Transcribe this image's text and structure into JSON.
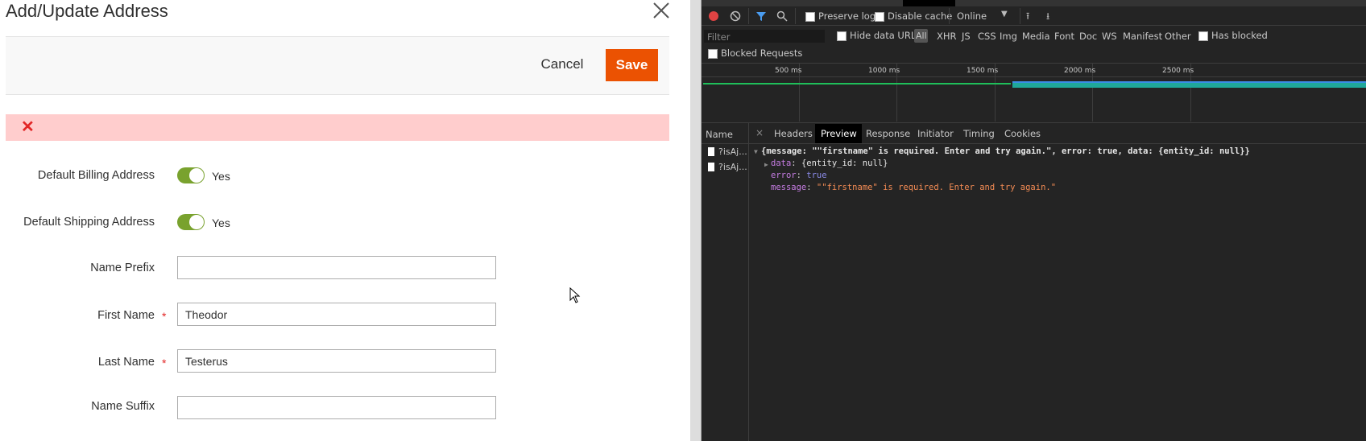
{
  "modal": {
    "title": "Add/Update Address",
    "cancel_label": "Cancel",
    "save_label": "Save",
    "fields": {
      "default_billing": {
        "label": "Default Billing Address",
        "value": "Yes"
      },
      "default_shipping": {
        "label": "Default Shipping Address",
        "value": "Yes"
      },
      "name_prefix": {
        "label": "Name Prefix",
        "value": ""
      },
      "first_name": {
        "label": "First Name",
        "value": "Theodor",
        "required": "*"
      },
      "last_name": {
        "label": "Last Name",
        "value": "Testerus",
        "required": "*"
      },
      "name_suffix": {
        "label": "Name Suffix",
        "value": ""
      }
    }
  },
  "devtools": {
    "toolbar": {
      "preserve_log": "Preserve log",
      "disable_cache": "Disable cache",
      "throttle": "Online"
    },
    "filter": {
      "placeholder": "Filter",
      "hide_data_urls": "Hide data URLs",
      "types": [
        "All",
        "XHR",
        "JS",
        "CSS",
        "Img",
        "Media",
        "Font",
        "Doc",
        "WS",
        "Manifest",
        "Other"
      ],
      "has_blocked": "Has blocked",
      "blocked_requests": "Blocked Requests"
    },
    "timeline": {
      "ticks": [
        "500 ms",
        "1000 ms",
        "1500 ms",
        "2000 ms",
        "2500 ms"
      ]
    },
    "requests": {
      "header": "Name",
      "items": [
        "?isAj...",
        "?isAj..."
      ]
    },
    "detail_tabs": [
      "Headers",
      "Preview",
      "Response",
      "Initiator",
      "Timing",
      "Cookies"
    ],
    "preview": {
      "summary": "{message: \"\"firstname\" is required. Enter and try again.\", error: true, data: {entity_id: null}}",
      "data_key": "data",
      "data_val": "{entity_id: null}",
      "error_key": "error",
      "error_val": "true",
      "message_key": "message",
      "message_val": "\"\"firstname\" is required. Enter and try again.\""
    }
  },
  "colors": {
    "save": "#eb5202",
    "error_bg": "#ffcdcd",
    "toggle_on": "#79a22e",
    "required": "#e22626"
  }
}
